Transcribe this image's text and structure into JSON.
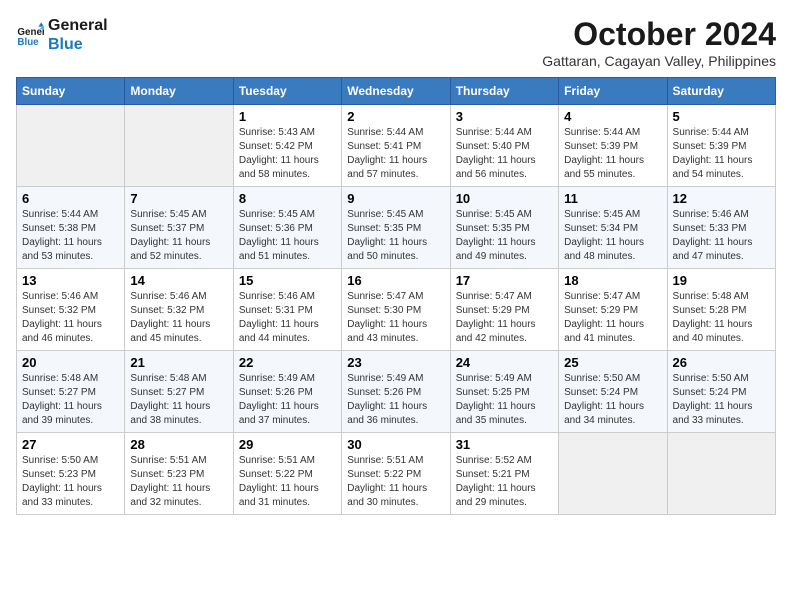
{
  "header": {
    "logo_line1": "General",
    "logo_line2": "Blue",
    "month": "October 2024",
    "location": "Gattaran, Cagayan Valley, Philippines"
  },
  "days_of_week": [
    "Sunday",
    "Monday",
    "Tuesday",
    "Wednesday",
    "Thursday",
    "Friday",
    "Saturday"
  ],
  "weeks": [
    [
      {
        "day": "",
        "empty": true
      },
      {
        "day": "",
        "empty": true
      },
      {
        "day": "1",
        "sunrise": "Sunrise: 5:43 AM",
        "sunset": "Sunset: 5:42 PM",
        "daylight": "Daylight: 11 hours and 58 minutes."
      },
      {
        "day": "2",
        "sunrise": "Sunrise: 5:44 AM",
        "sunset": "Sunset: 5:41 PM",
        "daylight": "Daylight: 11 hours and 57 minutes."
      },
      {
        "day": "3",
        "sunrise": "Sunrise: 5:44 AM",
        "sunset": "Sunset: 5:40 PM",
        "daylight": "Daylight: 11 hours and 56 minutes."
      },
      {
        "day": "4",
        "sunrise": "Sunrise: 5:44 AM",
        "sunset": "Sunset: 5:39 PM",
        "daylight": "Daylight: 11 hours and 55 minutes."
      },
      {
        "day": "5",
        "sunrise": "Sunrise: 5:44 AM",
        "sunset": "Sunset: 5:39 PM",
        "daylight": "Daylight: 11 hours and 54 minutes."
      }
    ],
    [
      {
        "day": "6",
        "sunrise": "Sunrise: 5:44 AM",
        "sunset": "Sunset: 5:38 PM",
        "daylight": "Daylight: 11 hours and 53 minutes."
      },
      {
        "day": "7",
        "sunrise": "Sunrise: 5:45 AM",
        "sunset": "Sunset: 5:37 PM",
        "daylight": "Daylight: 11 hours and 52 minutes."
      },
      {
        "day": "8",
        "sunrise": "Sunrise: 5:45 AM",
        "sunset": "Sunset: 5:36 PM",
        "daylight": "Daylight: 11 hours and 51 minutes."
      },
      {
        "day": "9",
        "sunrise": "Sunrise: 5:45 AM",
        "sunset": "Sunset: 5:35 PM",
        "daylight": "Daylight: 11 hours and 50 minutes."
      },
      {
        "day": "10",
        "sunrise": "Sunrise: 5:45 AM",
        "sunset": "Sunset: 5:35 PM",
        "daylight": "Daylight: 11 hours and 49 minutes."
      },
      {
        "day": "11",
        "sunrise": "Sunrise: 5:45 AM",
        "sunset": "Sunset: 5:34 PM",
        "daylight": "Daylight: 11 hours and 48 minutes."
      },
      {
        "day": "12",
        "sunrise": "Sunrise: 5:46 AM",
        "sunset": "Sunset: 5:33 PM",
        "daylight": "Daylight: 11 hours and 47 minutes."
      }
    ],
    [
      {
        "day": "13",
        "sunrise": "Sunrise: 5:46 AM",
        "sunset": "Sunset: 5:32 PM",
        "daylight": "Daylight: 11 hours and 46 minutes."
      },
      {
        "day": "14",
        "sunrise": "Sunrise: 5:46 AM",
        "sunset": "Sunset: 5:32 PM",
        "daylight": "Daylight: 11 hours and 45 minutes."
      },
      {
        "day": "15",
        "sunrise": "Sunrise: 5:46 AM",
        "sunset": "Sunset: 5:31 PM",
        "daylight": "Daylight: 11 hours and 44 minutes."
      },
      {
        "day": "16",
        "sunrise": "Sunrise: 5:47 AM",
        "sunset": "Sunset: 5:30 PM",
        "daylight": "Daylight: 11 hours and 43 minutes."
      },
      {
        "day": "17",
        "sunrise": "Sunrise: 5:47 AM",
        "sunset": "Sunset: 5:29 PM",
        "daylight": "Daylight: 11 hours and 42 minutes."
      },
      {
        "day": "18",
        "sunrise": "Sunrise: 5:47 AM",
        "sunset": "Sunset: 5:29 PM",
        "daylight": "Daylight: 11 hours and 41 minutes."
      },
      {
        "day": "19",
        "sunrise": "Sunrise: 5:48 AM",
        "sunset": "Sunset: 5:28 PM",
        "daylight": "Daylight: 11 hours and 40 minutes."
      }
    ],
    [
      {
        "day": "20",
        "sunrise": "Sunrise: 5:48 AM",
        "sunset": "Sunset: 5:27 PM",
        "daylight": "Daylight: 11 hours and 39 minutes."
      },
      {
        "day": "21",
        "sunrise": "Sunrise: 5:48 AM",
        "sunset": "Sunset: 5:27 PM",
        "daylight": "Daylight: 11 hours and 38 minutes."
      },
      {
        "day": "22",
        "sunrise": "Sunrise: 5:49 AM",
        "sunset": "Sunset: 5:26 PM",
        "daylight": "Daylight: 11 hours and 37 minutes."
      },
      {
        "day": "23",
        "sunrise": "Sunrise: 5:49 AM",
        "sunset": "Sunset: 5:26 PM",
        "daylight": "Daylight: 11 hours and 36 minutes."
      },
      {
        "day": "24",
        "sunrise": "Sunrise: 5:49 AM",
        "sunset": "Sunset: 5:25 PM",
        "daylight": "Daylight: 11 hours and 35 minutes."
      },
      {
        "day": "25",
        "sunrise": "Sunrise: 5:50 AM",
        "sunset": "Sunset: 5:24 PM",
        "daylight": "Daylight: 11 hours and 34 minutes."
      },
      {
        "day": "26",
        "sunrise": "Sunrise: 5:50 AM",
        "sunset": "Sunset: 5:24 PM",
        "daylight": "Daylight: 11 hours and 33 minutes."
      }
    ],
    [
      {
        "day": "27",
        "sunrise": "Sunrise: 5:50 AM",
        "sunset": "Sunset: 5:23 PM",
        "daylight": "Daylight: 11 hours and 33 minutes."
      },
      {
        "day": "28",
        "sunrise": "Sunrise: 5:51 AM",
        "sunset": "Sunset: 5:23 PM",
        "daylight": "Daylight: 11 hours and 32 minutes."
      },
      {
        "day": "29",
        "sunrise": "Sunrise: 5:51 AM",
        "sunset": "Sunset: 5:22 PM",
        "daylight": "Daylight: 11 hours and 31 minutes."
      },
      {
        "day": "30",
        "sunrise": "Sunrise: 5:51 AM",
        "sunset": "Sunset: 5:22 PM",
        "daylight": "Daylight: 11 hours and 30 minutes."
      },
      {
        "day": "31",
        "sunrise": "Sunrise: 5:52 AM",
        "sunset": "Sunset: 5:21 PM",
        "daylight": "Daylight: 11 hours and 29 minutes."
      },
      {
        "day": "",
        "empty": true
      },
      {
        "day": "",
        "empty": true
      }
    ]
  ]
}
